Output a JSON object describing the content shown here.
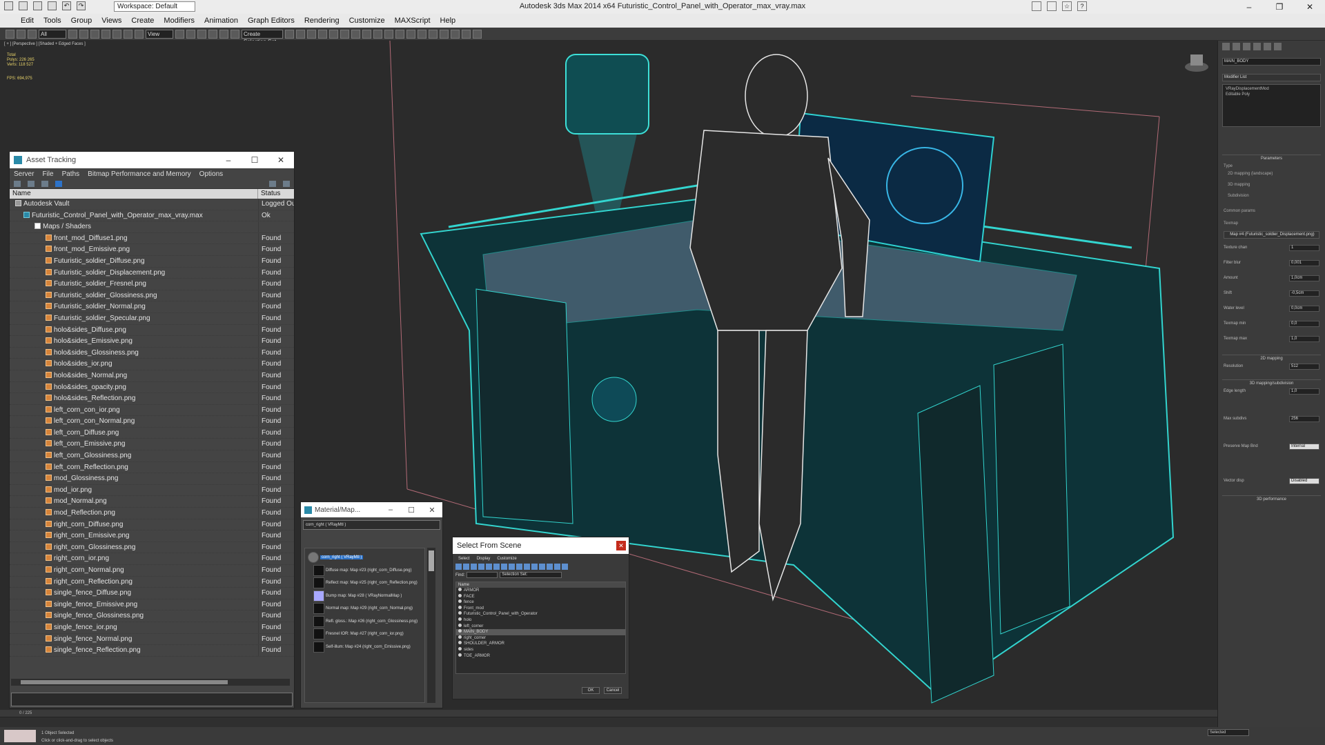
{
  "app": {
    "title": "Autodesk 3ds Max  2014 x64      Futuristic_Control_Panel_with_Operator_max_vray.max",
    "workspace": "Workspace: Default"
  },
  "menu": [
    "Edit",
    "Tools",
    "Group",
    "Views",
    "Create",
    "Modifiers",
    "Animation",
    "Graph Editors",
    "Rendering",
    "Customize",
    "MAXScript",
    "Help"
  ],
  "toolbar": {
    "selection_filter": "All",
    "ref_coord": "View",
    "named_sel": "Create Selection Set"
  },
  "viewport": {
    "label": "[ + ] [Perspective ] [Shaded + Edged Faces ]",
    "stats_total": "Total",
    "polys": "Polys:  226 265",
    "verts": "Verts:  118 527",
    "fps": "FPS:    694,975"
  },
  "asset_tracking": {
    "title": "Asset Tracking",
    "menu": [
      "Server",
      "File",
      "Paths",
      "Bitmap Performance and Memory",
      "Options"
    ],
    "col_name": "Name",
    "col_status": "Status",
    "rows": [
      {
        "name": "Autodesk Vault",
        "status": "Logged Ou",
        "indent": 8,
        "icon": "vault"
      },
      {
        "name": "Futuristic_Control_Panel_with_Operator_max_vray.max",
        "status": "Ok",
        "indent": 20,
        "icon": "max"
      },
      {
        "name": "Maps / Shaders",
        "status": "",
        "indent": 36,
        "icon": "folder"
      },
      {
        "name": "front_mod_Diffuse1.png",
        "status": "Found",
        "indent": 52,
        "icon": "file"
      },
      {
        "name": "front_mod_Emissive.png",
        "status": "Found",
        "indent": 52,
        "icon": "file"
      },
      {
        "name": "Futuristic_soldier_Diffuse.png",
        "status": "Found",
        "indent": 52,
        "icon": "file"
      },
      {
        "name": "Futuristic_soldier_Displacement.png",
        "status": "Found",
        "indent": 52,
        "icon": "file"
      },
      {
        "name": "Futuristic_soldier_Fresnel.png",
        "status": "Found",
        "indent": 52,
        "icon": "file"
      },
      {
        "name": "Futuristic_soldier_Glossiness.png",
        "status": "Found",
        "indent": 52,
        "icon": "file"
      },
      {
        "name": "Futuristic_soldier_Normal.png",
        "status": "Found",
        "indent": 52,
        "icon": "file"
      },
      {
        "name": "Futuristic_soldier_Specular.png",
        "status": "Found",
        "indent": 52,
        "icon": "file"
      },
      {
        "name": "holo&sides_Diffuse.png",
        "status": "Found",
        "indent": 52,
        "icon": "file"
      },
      {
        "name": "holo&sides_Emissive.png",
        "status": "Found",
        "indent": 52,
        "icon": "file"
      },
      {
        "name": "holo&sides_Glossiness.png",
        "status": "Found",
        "indent": 52,
        "icon": "file"
      },
      {
        "name": "holo&sides_ior.png",
        "status": "Found",
        "indent": 52,
        "icon": "file"
      },
      {
        "name": "holo&sides_Normal.png",
        "status": "Found",
        "indent": 52,
        "icon": "file"
      },
      {
        "name": "holo&sides_opacity.png",
        "status": "Found",
        "indent": 52,
        "icon": "file"
      },
      {
        "name": "holo&sides_Reflection.png",
        "status": "Found",
        "indent": 52,
        "icon": "file"
      },
      {
        "name": "left_corn_con_ior.png",
        "status": "Found",
        "indent": 52,
        "icon": "file"
      },
      {
        "name": "left_corn_con_Normal.png",
        "status": "Found",
        "indent": 52,
        "icon": "file"
      },
      {
        "name": "left_corn_Diffuse.png",
        "status": "Found",
        "indent": 52,
        "icon": "file"
      },
      {
        "name": "left_corn_Emissive.png",
        "status": "Found",
        "indent": 52,
        "icon": "file"
      },
      {
        "name": "left_corn_Glossiness.png",
        "status": "Found",
        "indent": 52,
        "icon": "file"
      },
      {
        "name": "left_corn_Reflection.png",
        "status": "Found",
        "indent": 52,
        "icon": "file"
      },
      {
        "name": "mod_Glossiness.png",
        "status": "Found",
        "indent": 52,
        "icon": "file"
      },
      {
        "name": "mod_ior.png",
        "status": "Found",
        "indent": 52,
        "icon": "file"
      },
      {
        "name": "mod_Normal.png",
        "status": "Found",
        "indent": 52,
        "icon": "file"
      },
      {
        "name": "mod_Reflection.png",
        "status": "Found",
        "indent": 52,
        "icon": "file"
      },
      {
        "name": "right_corn_Diffuse.png",
        "status": "Found",
        "indent": 52,
        "icon": "file"
      },
      {
        "name": "right_corn_Emissive.png",
        "status": "Found",
        "indent": 52,
        "icon": "file"
      },
      {
        "name": "right_corn_Glossiness.png",
        "status": "Found",
        "indent": 52,
        "icon": "file"
      },
      {
        "name": "right_corn_ior.png",
        "status": "Found",
        "indent": 52,
        "icon": "file"
      },
      {
        "name": "right_corn_Normal.png",
        "status": "Found",
        "indent": 52,
        "icon": "file"
      },
      {
        "name": "right_corn_Reflection.png",
        "status": "Found",
        "indent": 52,
        "icon": "file"
      },
      {
        "name": "single_fence_Diffuse.png",
        "status": "Found",
        "indent": 52,
        "icon": "file"
      },
      {
        "name": "single_fence_Emissive.png",
        "status": "Found",
        "indent": 52,
        "icon": "file"
      },
      {
        "name": "single_fence_Glossiness.png",
        "status": "Found",
        "indent": 52,
        "icon": "file"
      },
      {
        "name": "single_fence_ior.png",
        "status": "Found",
        "indent": 52,
        "icon": "file"
      },
      {
        "name": "single_fence_Normal.png",
        "status": "Found",
        "indent": 52,
        "icon": "file"
      },
      {
        "name": "single_fence_Reflection.png",
        "status": "Found",
        "indent": 52,
        "icon": "file"
      }
    ]
  },
  "material_browser": {
    "title": "Material/Map...",
    "name_field": "corn_right  ( VRayMtl )",
    "root": "corn_right  ( VRayMtl )",
    "nodes": [
      {
        "label": "Diffuse map: Map #23 (right_corn_Diffuse.png)",
        "kind": "map"
      },
      {
        "label": "Reflect map: Map #25 (right_corn_Reflection.png)",
        "kind": "map"
      },
      {
        "label": "Bump map: Map #28 ( VRayNormalMap )",
        "kind": "bump"
      },
      {
        "label": "Normal map: Map #29 (right_corn_Normal.png)",
        "kind": "map"
      },
      {
        "label": "Refl. gloss.: Map #26 (right_corn_Glossiness.png)",
        "kind": "map"
      },
      {
        "label": "Fresnel IOR: Map #27 (right_corn_ior.png)",
        "kind": "map"
      },
      {
        "label": "Self-illum: Map #24 (right_corn_Emissive.png)",
        "kind": "map"
      }
    ]
  },
  "select_from_scene": {
    "title": "Select From Scene",
    "menu": [
      "Select",
      "Display",
      "Customize"
    ],
    "find_label": "Find:",
    "selection_set": "Selection Set:",
    "col_name": "Name",
    "items": [
      "ARMOR",
      "FACE",
      "fence",
      "Front_mod",
      "Futuristic_Control_Panel_with_Operator",
      "holo",
      "left_corner",
      "MAIN_BODY",
      "right_corner",
      "SHOULDER_ARMOR",
      "sides",
      "TOE_ARMOR"
    ],
    "highlighted": "MAIN_BODY",
    "ok": "OK",
    "cancel": "Cancel"
  },
  "command_panel": {
    "object_name": "MAIN_BODY",
    "modifier_list": "Modifier List",
    "stack": [
      "VRayDisplacementMod",
      "Editable Poly"
    ],
    "parameters": "Parameters",
    "type_label": "Type",
    "types": [
      "2D mapping (landscape)",
      "3D mapping",
      "Subdivision"
    ],
    "common": "Common params",
    "texmap": "Texmap",
    "texmap_value": "Map #4 (Futuristic_soldier_Displacement.png)",
    "params": [
      {
        "label": "Texture chan",
        "value": "1"
      },
      {
        "label": "Filter blur",
        "value": "0,001"
      },
      {
        "label": "Amount",
        "value": "1,0cm"
      },
      {
        "label": "Shift",
        "value": "-0,5cm"
      },
      {
        "label": "Water level",
        "value": "0,0cm"
      },
      {
        "label": "Texmap min",
        "value": "0,0"
      },
      {
        "label": "Texmap max",
        "value": "1,0"
      }
    ],
    "section_2d": "2D mapping",
    "resolution_label": "Resolution",
    "resolution": "512",
    "section_3d": "3D mapping/subdivision",
    "edge_length_label": "Edge length",
    "edge_length": "1,0",
    "max_subdivs_label": "Max subdivs",
    "max_subdivs": "256",
    "preserve_label": "Preserve Map Bnd",
    "preserve": "Internal",
    "vector_label": "Vector disp",
    "vector": "Disabled",
    "section_perf": "3D performance"
  },
  "timeline": {
    "frame": "0 / 225"
  },
  "status": {
    "selected": "1 Object Selected",
    "prompt": "Click or click-and-drag to select objects",
    "key_mode": "Selected"
  }
}
